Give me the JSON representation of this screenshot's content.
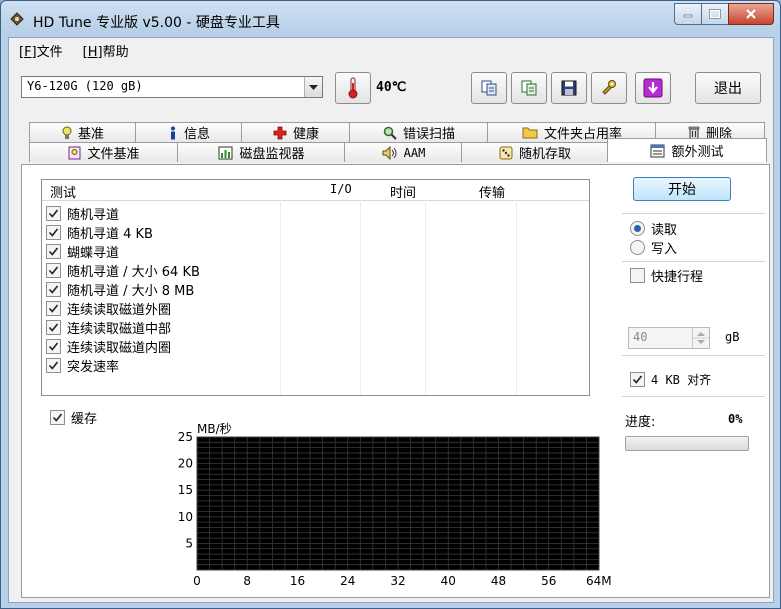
{
  "window": {
    "title": "HD Tune 专业版 v5.00 - 硬盘专业工具"
  },
  "menu": {
    "file_key": "[F]",
    "file_label": "文件",
    "help_key": "[H]",
    "help_label": "帮助"
  },
  "toolbar": {
    "drive": "Y6-120G (120 gB)",
    "temperature": "40℃",
    "exit_label": "退出"
  },
  "tabs": {
    "row1": [
      "基准",
      "信息",
      "健康",
      "错误扫描",
      "文件夹占用率",
      "删除"
    ],
    "row2": [
      "文件基准",
      "磁盘监视器",
      "AAM",
      "随机存取",
      "额外测试"
    ],
    "active": "额外测试"
  },
  "test_list": {
    "columns": [
      "测试",
      "I/O",
      "时间",
      "传输"
    ],
    "items": [
      {
        "label": "随机寻道",
        "checked": true
      },
      {
        "label": "随机寻道 4 KB",
        "checked": true
      },
      {
        "label": "蝴蝶寻道",
        "checked": true
      },
      {
        "label": "随机寻道 / 大小 64 KB",
        "checked": true
      },
      {
        "label": "随机寻道 / 大小 8 MB",
        "checked": true
      },
      {
        "label": "连续读取磁道外圈",
        "checked": true
      },
      {
        "label": "连续读取磁道中部",
        "checked": true
      },
      {
        "label": "连续读取磁道内圈",
        "checked": true
      },
      {
        "label": "突发速率",
        "checked": true
      }
    ]
  },
  "cache": {
    "label": "缓存",
    "checked": true
  },
  "controls": {
    "start_label": "开始",
    "read_label": "读取",
    "write_label": "写入",
    "mode": "read",
    "quick_label": "快捷行程",
    "quick_checked": false,
    "quick_value": "40",
    "quick_unit": "gB",
    "align_label": "4 KB 对齐",
    "align_checked": true,
    "progress_label": "进度:",
    "progress_value": "0%",
    "progress": 0
  },
  "chart_data": {
    "type": "line",
    "ylabel": "MB/秒",
    "ylim": [
      0,
      25
    ],
    "yticks": [
      5,
      10,
      15,
      20,
      25
    ],
    "xlim": [
      0,
      64
    ],
    "xticks": [
      "0",
      "8",
      "16",
      "24",
      "32",
      "40",
      "48",
      "56",
      "64MB"
    ],
    "series": [],
    "grid": true,
    "background": "#000000",
    "grid_color": "#3a3a3a"
  }
}
